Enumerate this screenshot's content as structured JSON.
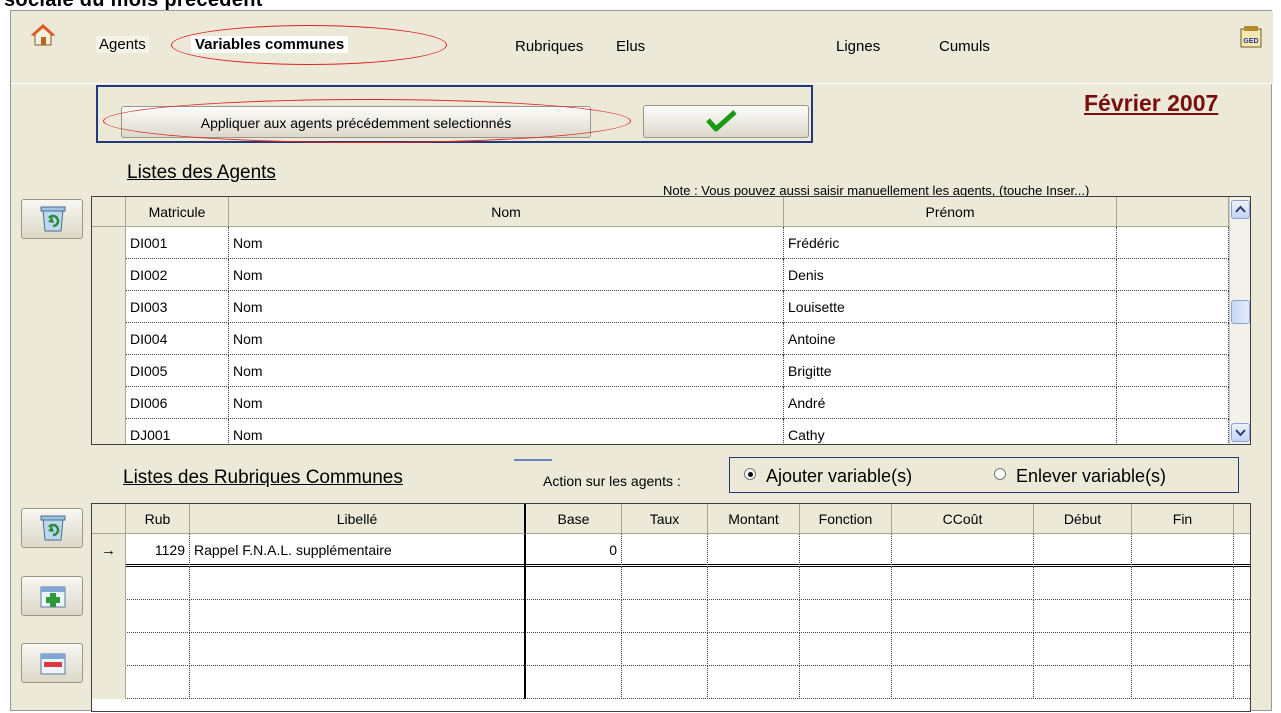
{
  "window_title_fragment": "sociale du mois précédent",
  "menu": {
    "agents": "Agents",
    "variables": "Variables communes",
    "rubriques": "Rubriques",
    "elus": "Elus",
    "lignes": "Lignes",
    "cumuls": "Cumuls"
  },
  "ged_label": "GED",
  "period": "Février 2007",
  "apply_button": "Appliquer aux agents précédemment selectionnés",
  "agents_section": {
    "title": "Listes des Agents",
    "note": "Note : Vous pouvez aussi saisir manuellement les agents, (touche Inser...)",
    "columns": [
      "Matricule",
      "Nom",
      "Prénom"
    ],
    "rows": [
      {
        "matricule": "DI001",
        "nom": "Nom",
        "prenom": "Frédéric"
      },
      {
        "matricule": "DI002",
        "nom": "Nom",
        "prenom": "Denis"
      },
      {
        "matricule": "DI003",
        "nom": "Nom",
        "prenom": "Louisette"
      },
      {
        "matricule": "DI004",
        "nom": "Nom",
        "prenom": "Antoine"
      },
      {
        "matricule": "DI005",
        "nom": "Nom",
        "prenom": "Brigitte"
      },
      {
        "matricule": "DI006",
        "nom": "Nom",
        "prenom": "André"
      },
      {
        "matricule": "DJ001",
        "nom": "Nom",
        "prenom": "Cathy"
      }
    ]
  },
  "rubriques_section": {
    "title": "Listes des Rubriques Communes",
    "action_label": "Action sur les agents :",
    "options": [
      "Ajouter variable(s)",
      "Enlever variable(s)"
    ],
    "selected_option": "Ajouter variable(s)",
    "columns": [
      "Rub",
      "Libellé",
      "Base",
      "Taux",
      "Montant",
      "Fonction",
      "CCoût",
      "Début",
      "Fin"
    ],
    "rows": [
      {
        "rub": "1129",
        "libelle": "Rappel F.N.A.L. supplémentaire",
        "base": "0",
        "taux": "",
        "montant": "",
        "fonction": "",
        "ccout": "",
        "debut": "",
        "fin": ""
      }
    ],
    "current_row_marker": "→"
  },
  "colors": {
    "period": "#7a0e0e",
    "highlight_ellipse": "#e02020",
    "frame": "#233a7a",
    "background": "#ece9d8"
  },
  "icons": [
    "home-icon",
    "ged-icon",
    "checkmark-icon",
    "recycle-bin-icon",
    "add-row-icon",
    "delete-row-icon"
  ]
}
